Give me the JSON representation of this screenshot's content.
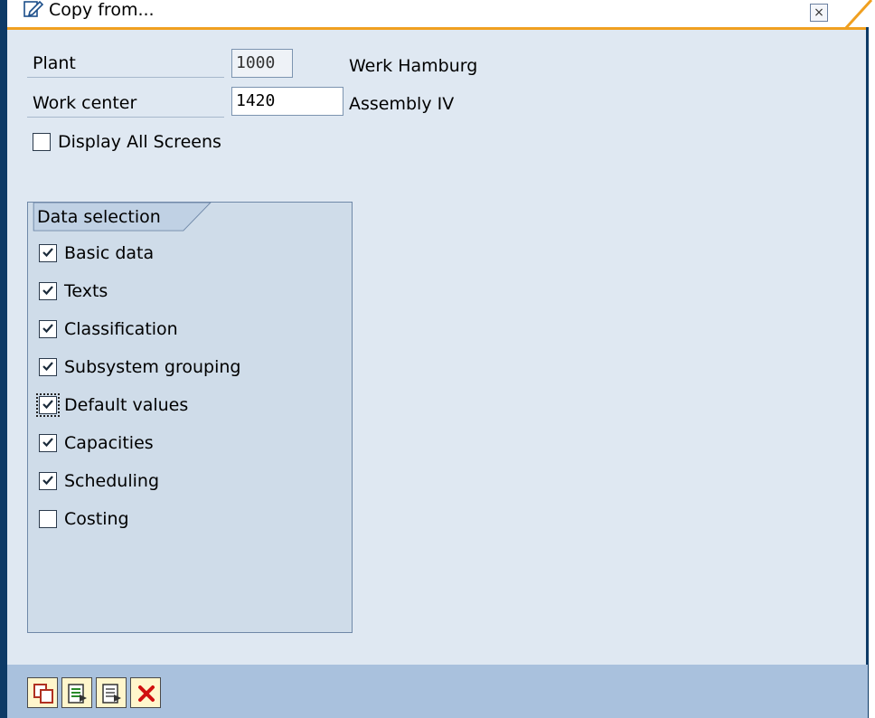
{
  "window": {
    "title": "Copy from...",
    "close_label": "×"
  },
  "fields": {
    "plant": {
      "label": "Plant",
      "value": "1000",
      "description": "Werk Hamburg"
    },
    "work_center": {
      "label": "Work center",
      "value": "1420",
      "description": "Assembly IV"
    }
  },
  "display_all_screens": {
    "label": "Display All Screens",
    "checked": false
  },
  "data_selection": {
    "title": "Data selection",
    "items": [
      {
        "label": "Basic data",
        "checked": true
      },
      {
        "label": "Texts",
        "checked": true
      },
      {
        "label": "Classification",
        "checked": true
      },
      {
        "label": "Subsystem grouping",
        "checked": true
      },
      {
        "label": "Default values",
        "checked": true,
        "focused": true
      },
      {
        "label": "Capacities",
        "checked": true
      },
      {
        "label": "Scheduling",
        "checked": true
      },
      {
        "label": "Costing",
        "checked": false
      }
    ]
  },
  "toolbar": {
    "buttons": [
      {
        "icon": "copy-icon"
      },
      {
        "icon": "select-all-icon"
      },
      {
        "icon": "deselect-all-icon"
      },
      {
        "icon": "cancel-icon"
      }
    ]
  },
  "colors": {
    "accent_orange": "#f0a020",
    "frame_blue": "#0d3a66",
    "toolbar_blue": "#a9c1dd",
    "panel_bg": "#dfe8f2",
    "group_bg": "#cfdce9",
    "cancel_red": "#d01010"
  }
}
